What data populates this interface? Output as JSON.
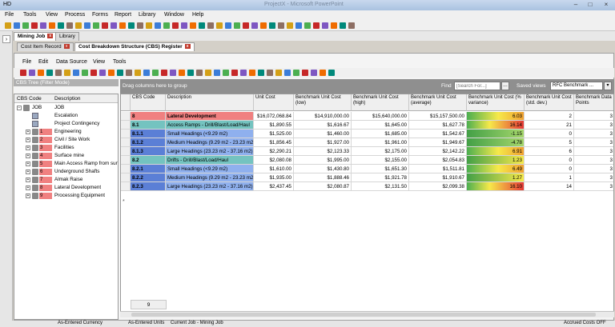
{
  "window": {
    "title": "HD",
    "blurred_title": "ProjectX - Microsoft PowerPoint"
  },
  "menu": [
    "File",
    "Tools",
    "View",
    "Process",
    "Forms",
    "Report",
    "Library",
    "Window",
    "Help"
  ],
  "doc_tabs": [
    {
      "label": "Mining Job",
      "active": true
    },
    {
      "label": "Library",
      "active": false
    }
  ],
  "sub_tabs": [
    {
      "label": "Cost Item Record",
      "active": false
    },
    {
      "label": "Cost Breakdown Structure (CBS) Register",
      "active": true
    }
  ],
  "inner_menu": [
    "File",
    "Edit",
    "Data Source",
    "View",
    "Tools"
  ],
  "tree": {
    "header": "CBS Tree (Filter Mode)",
    "columns": [
      "CBS Code",
      "Description"
    ],
    "rows": [
      {
        "code": "JOB",
        "desc": "JOB",
        "kind": "root"
      },
      {
        "code": "",
        "desc": "Escalation",
        "kind": "doc"
      },
      {
        "code": "",
        "desc": "Project Contingency",
        "kind": "doc"
      },
      {
        "code": "1",
        "desc": "Engineering",
        "kind": "node"
      },
      {
        "code": "2",
        "desc": "Civil / Site Work",
        "kind": "node"
      },
      {
        "code": "3",
        "desc": "Facilities",
        "kind": "node"
      },
      {
        "code": "4",
        "desc": "Surface mine",
        "kind": "node"
      },
      {
        "code": "5",
        "desc": "Main Access Ramp from surface",
        "kind": "node"
      },
      {
        "code": "6",
        "desc": "Underground Shafts",
        "kind": "node"
      },
      {
        "code": "7",
        "desc": "Almak Raise",
        "kind": "node"
      },
      {
        "code": "8",
        "desc": "Lateral Development",
        "kind": "node"
      },
      {
        "code": "9",
        "desc": "Processing Equipment",
        "kind": "node"
      }
    ]
  },
  "grid": {
    "group_hint": "Drag columns here to group",
    "find_label": "Find",
    "find_placeholder": "[Search For...]",
    "saved_views_label": "Saved views",
    "saved_views_value": "RFC Benchmark ...",
    "columns": [
      "CBS Code",
      "Description",
      "Unit Cost",
      "Benchmark Unit Cost (low)",
      "Benchmark Unit Cost (high)",
      "Benchmark Unit Cost (average)",
      "Benchmark Unit Cost (% variance)",
      "Benchmark Unit Cost (std. dev.)",
      "Benchmark Data Points"
    ],
    "rows": [
      {
        "code": "8",
        "desc": "Lateral Development",
        "unit": "$16,072,068.84",
        "low": "$14,910,000.00",
        "high": "$15,640,000.00",
        "avg": "$15,157,500.00",
        "var": "6.03",
        "std": "2",
        "pts": "3",
        "level": 0
      },
      {
        "code": "8.1",
        "desc": "Access Ramps - Drill/Blast/Load/Haul",
        "unit": "$1,890.55",
        "low": "$1,616.67",
        "high": "$1,645.00",
        "avg": "$1,627.78",
        "var": "16.14",
        "std": "21",
        "pts": "3",
        "level": 1
      },
      {
        "code": "8.1.1",
        "desc": "Small Headings (<9.29 m2)",
        "unit": "$1,525.00",
        "low": "$1,460.00",
        "high": "$1,685.00",
        "avg": "$1,542.67",
        "var": "-1.15",
        "std": "0",
        "pts": "3",
        "level": 2
      },
      {
        "code": "8.1.2",
        "desc": "Medium Headings (9.29 m2 - 23.23 m2)",
        "unit": "$1,856.45",
        "low": "$1,927.00",
        "high": "$1,961.00",
        "avg": "$1,949.67",
        "var": "-4.78",
        "std": "5",
        "pts": "3",
        "level": 2
      },
      {
        "code": "8.1.3",
        "desc": "Large Headings (23.23 m2 - 37.16 m2)",
        "unit": "$2,290.21",
        "low": "$2,123.33",
        "high": "$2,175.00",
        "avg": "$2,142.22",
        "var": "6.91",
        "std": "6",
        "pts": "3",
        "level": 2
      },
      {
        "code": "8.2",
        "desc": "Drifts - Drill/Blast/Load/Haul",
        "unit": "$2,080.08",
        "low": "$1,995.00",
        "high": "$2,155.00",
        "avg": "$2,054.83",
        "var": "1.23",
        "std": "0",
        "pts": "3",
        "level": 1
      },
      {
        "code": "8.2.1",
        "desc": "Small Headings (<9.29 m2)",
        "unit": "$1,610.00",
        "low": "$1,430.80",
        "high": "$1,651.30",
        "avg": "$1,511.81",
        "var": "6.49",
        "std": "0",
        "pts": "3",
        "level": 2
      },
      {
        "code": "8.2.2",
        "desc": "Medium Headings (9.29 m2 - 23.23 m2)",
        "unit": "$1,935.00",
        "low": "$1,888.46",
        "high": "$1,921.78",
        "avg": "$1,910.67",
        "var": "1.27",
        "std": "1",
        "pts": "3",
        "level": 2
      },
      {
        "code": "8.2.3",
        "desc": "Large Headings (23.23 m2 - 37.16 m2)",
        "unit": "$2,437.45",
        "low": "$2,080.87",
        "high": "$2,131.50",
        "avg": "$2,099.38",
        "var": "16.10",
        "std": "14",
        "pts": "3",
        "level": 2
      }
    ],
    "footer_count": "9"
  },
  "status": {
    "currency": "As-Entered Currency",
    "units": "As-Entered Units",
    "job": "Current Job - Mining Job",
    "accrued": "Accrued Costs OFF"
  },
  "colors": {
    "level0": "#f08080",
    "level1": "#74c3c0",
    "level2": "#5b7fd6",
    "var_hi": "#e53935",
    "var_mid": "#f6e94a",
    "var_lo": "#43a047"
  }
}
